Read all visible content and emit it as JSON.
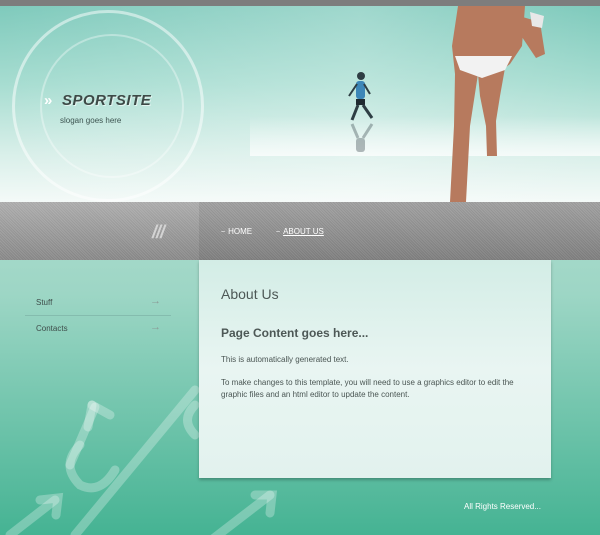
{
  "header": {
    "logo_mark": "»",
    "logo_text": "SPORTSITE",
    "slogan": "slogan goes here"
  },
  "nav": {
    "deco": "///",
    "items": [
      {
        "mark": "~",
        "label": "HOME",
        "active": false
      },
      {
        "mark": "~",
        "label": "ABOUT US",
        "active": true
      }
    ]
  },
  "sidebar": {
    "items": [
      {
        "label": "Stuff",
        "icon": "arrow-right-icon"
      },
      {
        "label": "Contacts",
        "icon": "arrow-right-icon"
      }
    ]
  },
  "content": {
    "heading": "About Us",
    "subheading": "Page Content goes here...",
    "paragraph1": "This is automatically generated text.",
    "paragraph2": "To make changes to this template, you will need to use a graphics editor to edit the graphic files and an html editor to update the content."
  },
  "footer": {
    "text": "All Rights Reserved..."
  },
  "colors": {
    "teal_dark": "#45b393",
    "teal_light": "#cfe6df",
    "nav_gray": "#8c8c8c",
    "top_bar": "#7d7d7d"
  }
}
